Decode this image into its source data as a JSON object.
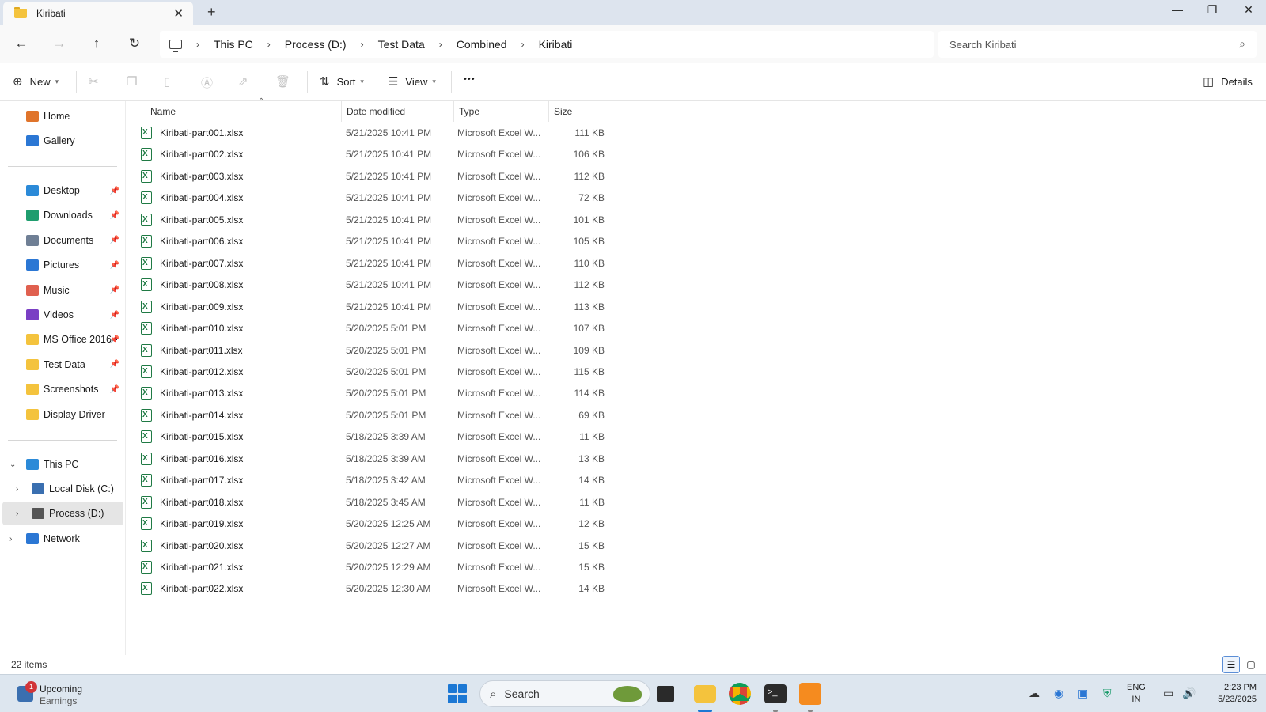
{
  "window": {
    "tab_title": "Kiribati",
    "tab_close": "✕",
    "new_tab": "+",
    "minimize": "—",
    "maximize": "❐",
    "close": "✕"
  },
  "nav": {
    "back": "←",
    "forward": "→",
    "up": "↑",
    "refresh": "↻",
    "breadcrumb": [
      "This PC",
      "Process (D:)",
      "Test Data",
      "Combined",
      "Kiribati"
    ],
    "separator": "›",
    "search_placeholder": "Search Kiribati"
  },
  "toolbar": {
    "new_label": "New",
    "sort_label": "Sort",
    "view_label": "View",
    "more_label": "•••",
    "details_label": "Details"
  },
  "sidebar": {
    "quick": [
      {
        "label": "Home",
        "icon": "home-icon",
        "color": "#e0742b"
      },
      {
        "label": "Gallery",
        "icon": "gallery-icon",
        "color": "#2b77d4"
      }
    ],
    "pinned": [
      {
        "label": "Desktop",
        "icon": "desktop-icon",
        "color": "#2b8ad8"
      },
      {
        "label": "Downloads",
        "icon": "downloads-icon",
        "color": "#1f9d6e"
      },
      {
        "label": "Documents",
        "icon": "documents-icon",
        "color": "#6f7f95"
      },
      {
        "label": "Pictures",
        "icon": "pictures-icon",
        "color": "#2b77d4"
      },
      {
        "label": "Music",
        "icon": "music-icon",
        "color": "#e0604f"
      },
      {
        "label": "Videos",
        "icon": "videos-icon",
        "color": "#7a3fc4"
      },
      {
        "label": "MS Office 2016 -",
        "icon": "folder-icon",
        "color": "#f4c33d"
      },
      {
        "label": "Test Data",
        "icon": "folder-icon",
        "color": "#f4c33d"
      },
      {
        "label": "Screenshots",
        "icon": "folder-icon",
        "color": "#f4c33d"
      },
      {
        "label": "Display Driver",
        "icon": "folder-icon",
        "color": "#f4c33d"
      }
    ],
    "tree": {
      "this_pc": "This PC",
      "local_disk": "Local Disk (C:)",
      "process_d": "Process (D:)",
      "network": "Network"
    }
  },
  "columns": {
    "name": "Name",
    "date": "Date modified",
    "type": "Type",
    "size": "Size"
  },
  "files": [
    {
      "name": "Kiribati-part001.xlsx",
      "date": "5/21/2025 10:41 PM",
      "type": "Microsoft Excel W...",
      "size": "111 KB"
    },
    {
      "name": "Kiribati-part002.xlsx",
      "date": "5/21/2025 10:41 PM",
      "type": "Microsoft Excel W...",
      "size": "106 KB"
    },
    {
      "name": "Kiribati-part003.xlsx",
      "date": "5/21/2025 10:41 PM",
      "type": "Microsoft Excel W...",
      "size": "112 KB"
    },
    {
      "name": "Kiribati-part004.xlsx",
      "date": "5/21/2025 10:41 PM",
      "type": "Microsoft Excel W...",
      "size": "72 KB"
    },
    {
      "name": "Kiribati-part005.xlsx",
      "date": "5/21/2025 10:41 PM",
      "type": "Microsoft Excel W...",
      "size": "101 KB"
    },
    {
      "name": "Kiribati-part006.xlsx",
      "date": "5/21/2025 10:41 PM",
      "type": "Microsoft Excel W...",
      "size": "105 KB"
    },
    {
      "name": "Kiribati-part007.xlsx",
      "date": "5/21/2025 10:41 PM",
      "type": "Microsoft Excel W...",
      "size": "110 KB"
    },
    {
      "name": "Kiribati-part008.xlsx",
      "date": "5/21/2025 10:41 PM",
      "type": "Microsoft Excel W...",
      "size": "112 KB"
    },
    {
      "name": "Kiribati-part009.xlsx",
      "date": "5/21/2025 10:41 PM",
      "type": "Microsoft Excel W...",
      "size": "113 KB"
    },
    {
      "name": "Kiribati-part010.xlsx",
      "date": "5/20/2025 5:01 PM",
      "type": "Microsoft Excel W...",
      "size": "107 KB"
    },
    {
      "name": "Kiribati-part011.xlsx",
      "date": "5/20/2025 5:01 PM",
      "type": "Microsoft Excel W...",
      "size": "109 KB"
    },
    {
      "name": "Kiribati-part012.xlsx",
      "date": "5/20/2025 5:01 PM",
      "type": "Microsoft Excel W...",
      "size": "115 KB"
    },
    {
      "name": "Kiribati-part013.xlsx",
      "date": "5/20/2025 5:01 PM",
      "type": "Microsoft Excel W...",
      "size": "114 KB"
    },
    {
      "name": "Kiribati-part014.xlsx",
      "date": "5/20/2025 5:01 PM",
      "type": "Microsoft Excel W...",
      "size": "69 KB"
    },
    {
      "name": "Kiribati-part015.xlsx",
      "date": "5/18/2025 3:39 AM",
      "type": "Microsoft Excel W...",
      "size": "11 KB"
    },
    {
      "name": "Kiribati-part016.xlsx",
      "date": "5/18/2025 3:39 AM",
      "type": "Microsoft Excel W...",
      "size": "13 KB"
    },
    {
      "name": "Kiribati-part017.xlsx",
      "date": "5/18/2025 3:42 AM",
      "type": "Microsoft Excel W...",
      "size": "14 KB"
    },
    {
      "name": "Kiribati-part018.xlsx",
      "date": "5/18/2025 3:45 AM",
      "type": "Microsoft Excel W...",
      "size": "11 KB"
    },
    {
      "name": "Kiribati-part019.xlsx",
      "date": "5/20/2025 12:25 AM",
      "type": "Microsoft Excel W...",
      "size": "12 KB"
    },
    {
      "name": "Kiribati-part020.xlsx",
      "date": "5/20/2025 12:27 AM",
      "type": "Microsoft Excel W...",
      "size": "15 KB"
    },
    {
      "name": "Kiribati-part021.xlsx",
      "date": "5/20/2025 12:29 AM",
      "type": "Microsoft Excel W...",
      "size": "15 KB"
    },
    {
      "name": "Kiribati-part022.xlsx",
      "date": "5/20/2025 12:30 AM",
      "type": "Microsoft Excel W...",
      "size": "14 KB"
    }
  ],
  "status": {
    "item_count": "22 items"
  },
  "taskbar": {
    "widget_badge": "1",
    "widget_title": "Upcoming",
    "widget_subtitle": "Earnings",
    "search_label": "Search",
    "lang_line1": "ENG",
    "lang_line2": "IN",
    "time": "2:23 PM",
    "date": "5/23/2025"
  },
  "colors": {
    "accent": "#1c78d4",
    "excel_green": "#1f7a44",
    "folder_yellow": "#f4c33d"
  }
}
